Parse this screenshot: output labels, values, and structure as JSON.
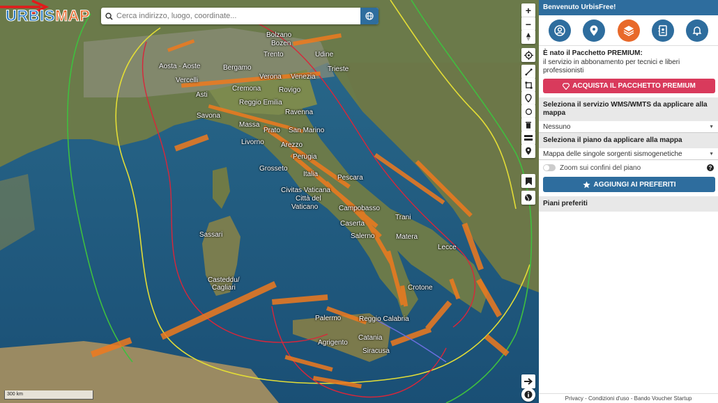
{
  "app": {
    "logo_part1": "URBIS",
    "logo_part2": "MAP"
  },
  "search": {
    "placeholder": "Cerca indirizzo, luogo, coordinate..."
  },
  "map": {
    "scale_label": "300 km",
    "cities": [
      "Bolzano",
      "Bozen",
      "Trento",
      "Udine",
      "Aosta - Aoste",
      "Bergamo",
      "Trieste",
      "Vercelli",
      "Verona",
      "Venezia",
      "Asti",
      "Cremona",
      "Rovigo",
      "Reggio Emilia",
      "Savona",
      "Ravenna",
      "Massa",
      "Prato",
      "San Marino",
      "Livorno",
      "Arezzo",
      "Perugia",
      "Grosseto",
      "Italia",
      "Pescara",
      "Civitas Vaticana",
      "Città del",
      "Vaticano",
      "Campobasso",
      "Trani",
      "Caserta",
      "Sassari",
      "Salerno",
      "Matera",
      "Lecce",
      "Casteddu/",
      "Cagliari",
      "Crotone",
      "Palermo",
      "Reggio Calabria",
      "Agrigento",
      "Catania",
      "Siracusa"
    ]
  },
  "sidebar": {
    "welcome": "Benvenuto UrbisFree!",
    "promo_title": "È nato il Pacchetto PREMIUM:",
    "promo_desc": "il servizio in abbonamento per tecnici e liberi professionisti",
    "buy_label": "ACQUISTA IL PACCHETTO PREMIUM",
    "wms_heading": "Seleziona il servizio WMS/WMTS da applicare alla mappa",
    "wms_value": "Nessuno",
    "plan_heading": "Seleziona il piano da applicare alla mappa",
    "plan_value": "Mappa delle singole sorgenti sismogenetiche",
    "zoom_label": "Zoom sui confini del piano",
    "help": "?",
    "fav_label": "AGGIUNGI AI PREFERITI",
    "favs_heading": "Piani preferiti"
  },
  "footer": {
    "privacy": "Privacy",
    "sep1": "-",
    "terms": "Condizioni d'uso",
    "sep2": "-",
    "voucher": "Bando Voucher Startup"
  },
  "colors": {
    "primary": "#2e6d9e",
    "accent": "#e8692a",
    "danger": "#d93a5c"
  }
}
